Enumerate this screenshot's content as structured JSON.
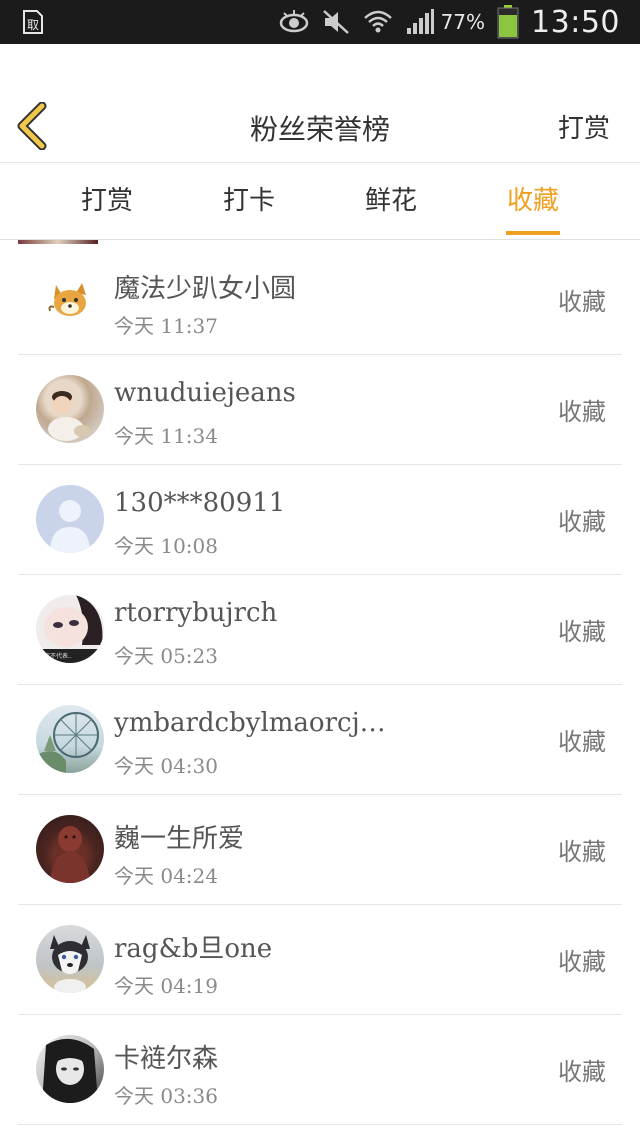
{
  "status_bar": {
    "battery_percent": "77%",
    "time": "13:50",
    "icons": [
      "sim-card-icon",
      "eye-icon",
      "mute-icon",
      "wifi-icon",
      "signal-icon",
      "battery-icon"
    ]
  },
  "header": {
    "title": "粉丝荣誉榜",
    "right_link": "打赏"
  },
  "tabs": [
    {
      "label": "打赏",
      "active": false
    },
    {
      "label": "打卡",
      "active": false
    },
    {
      "label": "鲜花",
      "active": false
    },
    {
      "label": "收藏",
      "active": true
    }
  ],
  "colors": {
    "accent": "#f0a020",
    "title_text": "#333333",
    "secondary_text": "#8a8a8a"
  },
  "fans": [
    {
      "name": "魔法少趴女小圆",
      "time": "今天 11:37",
      "action": "收藏",
      "avatar": "shiba-dog-icon"
    },
    {
      "name": "wnuduiejeans",
      "time": "今天 11:34",
      "action": "收藏",
      "avatar": "baby-photo"
    },
    {
      "name": "130***80911",
      "time": "今天 10:08",
      "action": "收藏",
      "avatar": "default-user-icon"
    },
    {
      "name": "rtorrybujrch",
      "time": "今天 05:23",
      "action": "收藏",
      "avatar": "girl-face-photo"
    },
    {
      "name": "ymbardcbylmaorcj…",
      "time": "今天 04:30",
      "action": "收藏",
      "avatar": "ferris-wheel-photo"
    },
    {
      "name": "巍一生所爱",
      "time": "今天 04:24",
      "action": "收藏",
      "avatar": "statue-photo"
    },
    {
      "name": "rag&b旦one",
      "time": "今天 04:19",
      "action": "收藏",
      "avatar": "husky-dog-photo"
    },
    {
      "name": "卡裢尔森",
      "time": "今天 03:36",
      "action": "收藏",
      "avatar": "girl-bw-photo"
    }
  ]
}
